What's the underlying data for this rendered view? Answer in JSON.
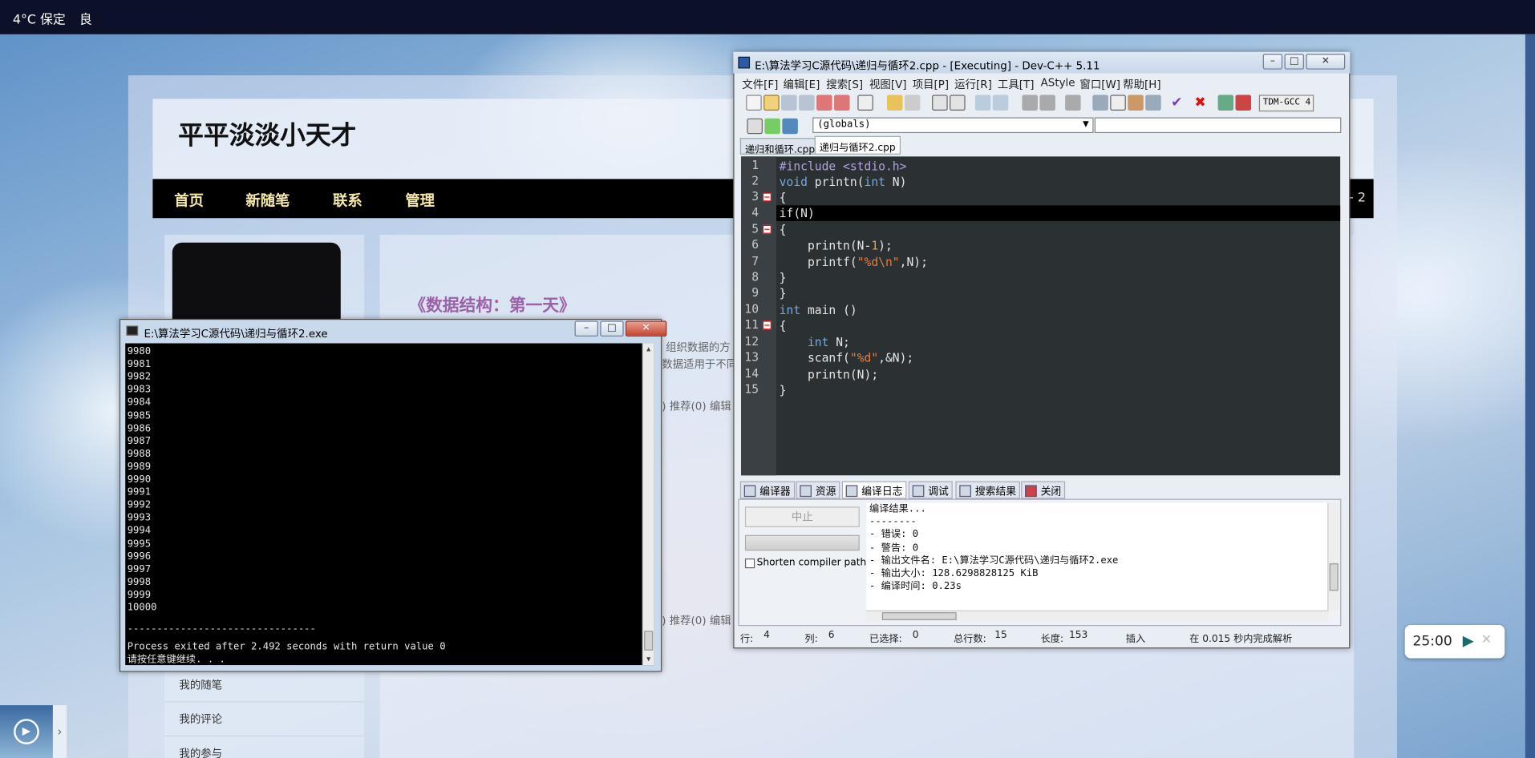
{
  "taskbar": {
    "weather": "4°C 保定",
    "aqi": "良"
  },
  "blog": {
    "title": "平平淡淡小天才",
    "nav": [
      "首页",
      "新随笔",
      "联系",
      "管理"
    ],
    "nav_right": "- 2",
    "post_title": "《数据结构：第一天》",
    "excerpt_1a": "组织数据的方",
    "excerpt_1b": "数据适用于不同",
    "meta_1": ") 推荐(0) 编辑",
    "meta_2": ") 推荐(0) 编辑",
    "side_links": [
      "我的随笔",
      "我的评论",
      "我的参与"
    ]
  },
  "console": {
    "title": "E:\\算法学习C源代码\\递归与循环2.exe",
    "lines": [
      "9980",
      "9981",
      "9982",
      "9983",
      "9984",
      "9985",
      "9986",
      "9987",
      "9988",
      "9989",
      "9990",
      "9991",
      "9992",
      "9993",
      "9994",
      "9995",
      "9996",
      "9997",
      "9998",
      "9999",
      "10000"
    ],
    "separator": "--------------------------------",
    "process_exit": "Process exited after 2.492 seconds with return value 0",
    "press_key": "请按任意键继续. . ."
  },
  "devcpp": {
    "title": "E:\\算法学习C源代码\\递归与循环2.cpp - [Executing] - Dev-C++ 5.11",
    "menu": [
      "文件[F]",
      "编辑[E]",
      "搜索[S]",
      "视图[V]",
      "项目[P]",
      "运行[R]",
      "工具[T]",
      "AStyle",
      "窗口[W]",
      "帮助[H]"
    ],
    "compiler_select": "TDM-GCC 4",
    "globals": "(globals)",
    "file_tabs": [
      "递归和循环.cpp",
      "递归与循环2.cpp"
    ],
    "line_numbers": [
      "1",
      "2",
      "3",
      "4",
      "5",
      "6",
      "7",
      "8",
      "9",
      "10",
      "11",
      "12",
      "13",
      "14",
      "15"
    ],
    "code": {
      "l1_pp": "#include <stdio.h>",
      "l2_kw": "void",
      "l2_rest": " printn(",
      "l2_kw2": "int",
      "l2_end": " N)",
      "l3": "{",
      "l4": "if(N)",
      "l5": "{",
      "l6_a": "    printn(N-",
      "l6_num": "1",
      "l6_b": ");",
      "l7_a": "    printf(",
      "l7_str": "\"%d\\n\"",
      "l7_b": ",N);",
      "l8": "}",
      "l9": "}",
      "l10_kw": "int",
      "l10_rest": " main ()",
      "l11": "{",
      "l12_kw": "    int",
      "l12_rest": " N;",
      "l13_a": "    scanf(",
      "l13_str": "\"%d\"",
      "l13_b": ",&N);",
      "l14": "    printn(N);",
      "l15": "}"
    },
    "bottom_tabs": [
      "编译器",
      "资源",
      "编译日志",
      "调试",
      "搜索结果",
      "关闭"
    ],
    "abort_button": "中止",
    "shorten_paths": "Shorten compiler paths",
    "log": [
      "编译结果...",
      "--------",
      "- 错误: 0",
      "- 警告: 0",
      "- 输出文件名: E:\\算法学习C源代码\\递归与循环2.exe",
      "- 输出大小: 128.6298828125 KiB",
      "- 编译时间: 0.23s"
    ],
    "status": {
      "row_label": "行:",
      "row": "4",
      "col_label": "列:",
      "col": "6",
      "sel_label": "已选择:",
      "sel": "0",
      "total_label": "总行数:",
      "total": "15",
      "len_label": "长度:",
      "len": "153",
      "mode": "插入",
      "parse": "在 0.015 秒内完成解析"
    }
  },
  "timer": {
    "time": "25:00"
  }
}
